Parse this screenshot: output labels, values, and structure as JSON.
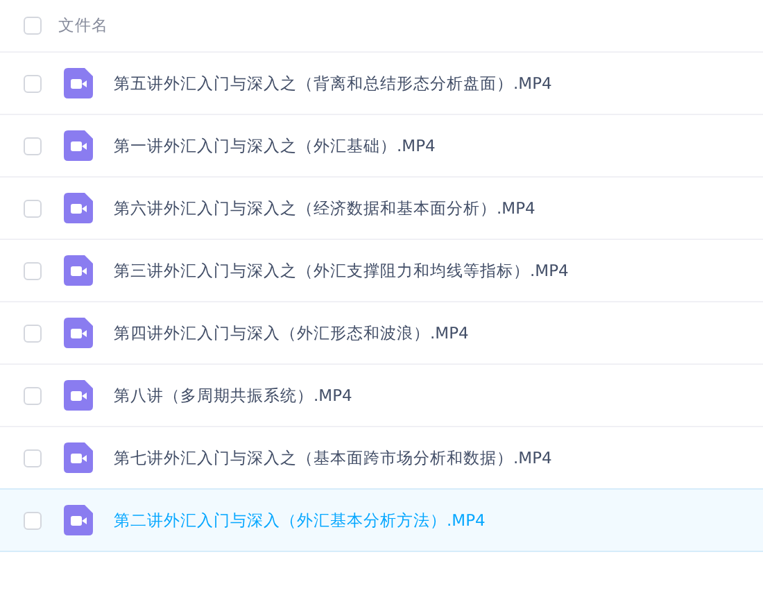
{
  "header": {
    "label": "文件名",
    "checked": false
  },
  "files": [
    {
      "name": "第五讲外汇入门与深入之（背离和总结形态分析盘面）.MP4",
      "checked": false,
      "selected": false
    },
    {
      "name": "第一讲外汇入门与深入之（外汇基础）.MP4",
      "checked": false,
      "selected": false
    },
    {
      "name": "第六讲外汇入门与深入之（经济数据和基本面分析）.MP4",
      "checked": false,
      "selected": false
    },
    {
      "name": "第三讲外汇入门与深入之（外汇支撑阻力和均线等指标）.MP4",
      "checked": false,
      "selected": false
    },
    {
      "name": "第四讲外汇入门与深入（外汇形态和波浪）.MP4",
      "checked": false,
      "selected": false
    },
    {
      "name": "第八讲（多周期共振系统）.MP4",
      "checked": false,
      "selected": false
    },
    {
      "name": "第七讲外汇入门与深入之（基本面跨市场分析和数据）.MP4",
      "checked": false,
      "selected": false
    },
    {
      "name": "第二讲外汇入门与深入（外汇基本分析方法）.MP4",
      "checked": false,
      "selected": true
    }
  ]
}
